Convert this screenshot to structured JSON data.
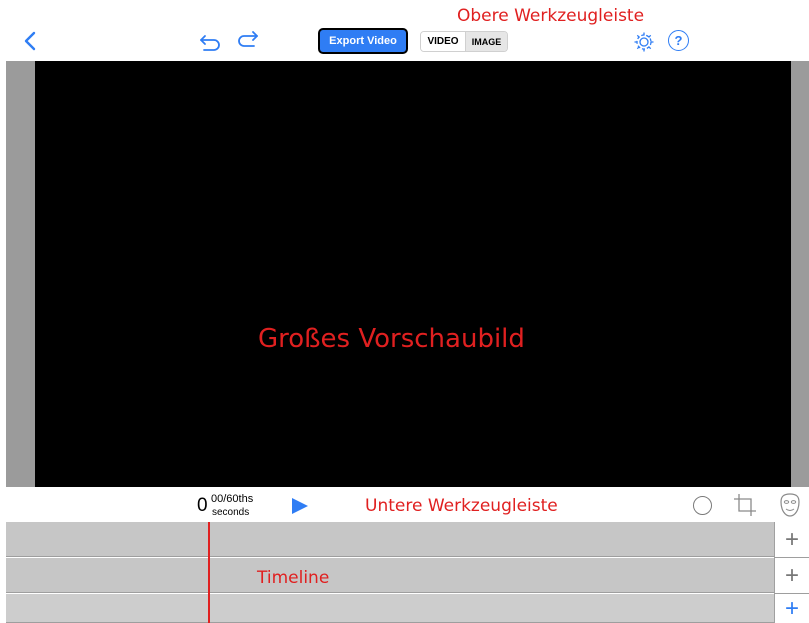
{
  "top_toolbar": {
    "back_icon": "chevron-left-icon",
    "undo_icon": "undo-icon",
    "redo_icon": "redo-icon",
    "export_label": "Export Video",
    "mode_options": [
      "VIDEO",
      "IMAGE"
    ],
    "mode_selected": "VIDEO",
    "settings_icon": "gear-icon",
    "help_label": "?",
    "accent_color": "#2f7df4"
  },
  "annotations": {
    "top_toolbar": "Obere Werkzeugleiste",
    "preview": "Großes Vorschaubild",
    "bottom_toolbar": "Untere Werkzeugleiste",
    "timeline": "Timeline",
    "color": "#e02020"
  },
  "bottom_toolbar": {
    "time_value": "0",
    "time_fraction": "00/60ths",
    "time_unit": "seconds",
    "play_icon": "play-icon",
    "tool_icons": [
      "circle-icon",
      "crop-icon",
      "mask-icon"
    ]
  },
  "timeline": {
    "tracks": [
      {
        "add_label": "+"
      },
      {
        "add_label": "+"
      },
      {
        "add_label": "+"
      }
    ]
  }
}
